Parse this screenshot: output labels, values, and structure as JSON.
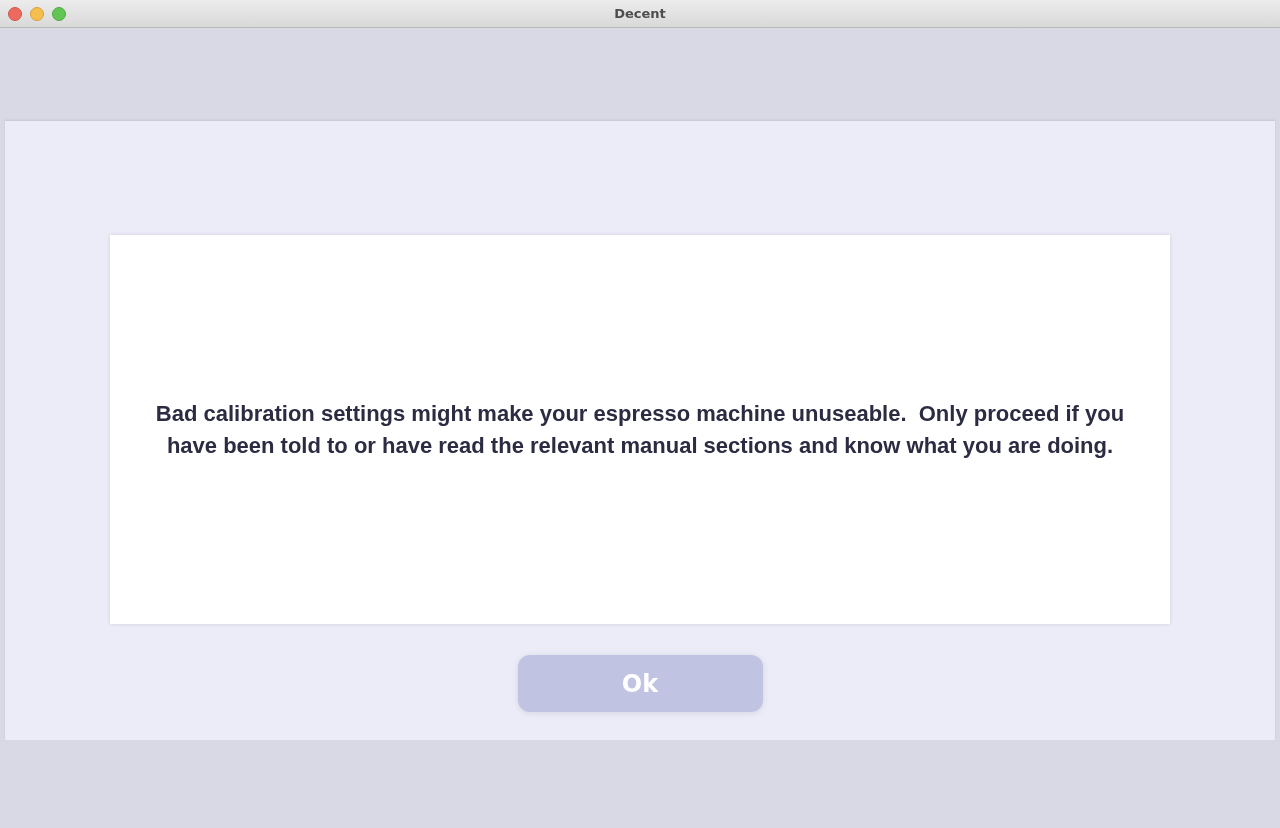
{
  "window": {
    "title": "Decent"
  },
  "message": "Bad calibration settings might make your espresso machine unuseable.  Only proceed if you have been told to or have read the relevant manual sections and know what you are doing.",
  "buttons": [
    "Ok"
  ]
}
